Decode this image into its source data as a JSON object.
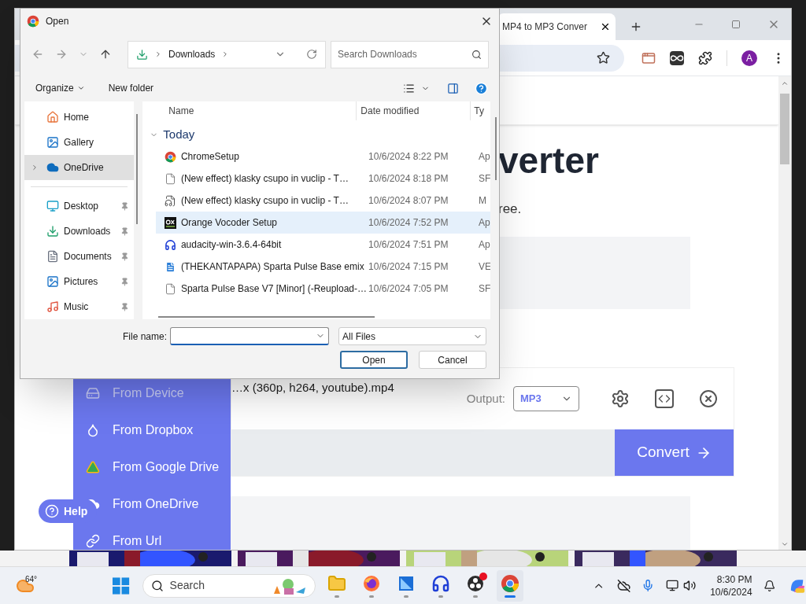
{
  "browser": {
    "tab_title": "MP4 to MP3 Conver",
    "avatar": "A",
    "page": {
      "heading": "verter",
      "subheading": "ree.",
      "file_name": "…x (360p, h264, youtube).mp4",
      "output_label": "Output:",
      "output_format": "MP3",
      "convert_button": "Convert",
      "help_button": "Help",
      "source_menu": [
        {
          "label": "From Device",
          "kind": "device",
          "dimmed": true
        },
        {
          "label": "From Dropbox",
          "kind": "dropbox",
          "dimmed": false
        },
        {
          "label": "From Google Drive",
          "kind": "gdrive",
          "dimmed": false
        },
        {
          "label": "From OneDrive",
          "kind": "onedrive",
          "dimmed": false
        },
        {
          "label": "From Url",
          "kind": "url",
          "dimmed": false
        }
      ]
    }
  },
  "dialog": {
    "title": "Open",
    "path": "Downloads",
    "search_placeholder": "Search Downloads",
    "organize": "Organize",
    "new_folder": "New folder",
    "nav_groups": [
      [
        {
          "label": "Home",
          "kind": "home",
          "selected": false,
          "pinned": false
        },
        {
          "label": "Gallery",
          "kind": "gallery",
          "selected": false,
          "pinned": false
        },
        {
          "label": "OneDrive",
          "kind": "onedrive",
          "selected": true,
          "pinned": false
        }
      ],
      [
        {
          "label": "Desktop",
          "kind": "desktop",
          "selected": false,
          "pinned": true
        },
        {
          "label": "Downloads",
          "kind": "downloads",
          "selected": false,
          "pinned": true
        },
        {
          "label": "Documents",
          "kind": "documents",
          "selected": false,
          "pinned": true
        },
        {
          "label": "Pictures",
          "kind": "pictures",
          "selected": false,
          "pinned": true
        },
        {
          "label": "Music",
          "kind": "music",
          "selected": false,
          "pinned": true
        }
      ]
    ],
    "columns": [
      "Name",
      "Date modified",
      "Ty"
    ],
    "group": "Today",
    "files": [
      {
        "name": "ChromeSetup",
        "date": "10/6/2024 8:22 PM",
        "type": "Ap",
        "kind": "installer",
        "selected": false
      },
      {
        "name": "(New effect) klasky csupo in vuclip - T…",
        "date": "10/6/2024 8:18 PM",
        "type": "SF",
        "kind": "file",
        "selected": false
      },
      {
        "name": "(New effect) klasky csupo in vuclip - T…",
        "date": "10/6/2024 8:07 PM",
        "type": "M",
        "kind": "media",
        "selected": false
      },
      {
        "name": "Orange Vocoder Setup",
        "date": "10/6/2024 7:52 PM",
        "type": "Ap",
        "kind": "vocoder",
        "selected": true
      },
      {
        "name": "audacity-win-3.6.4-64bit",
        "date": "10/6/2024 7:51 PM",
        "type": "Ap",
        "kind": "audacity",
        "selected": false
      },
      {
        "name": "(THEKANTAPAPA) Sparta Pulse Base emix",
        "date": "10/6/2024 7:15 PM",
        "type": "VE",
        "kind": "document",
        "selected": false
      },
      {
        "name": "Sparta Pulse Base V7 [Minor] (-Reupload-…",
        "date": "10/6/2024 7:05 PM",
        "type": "SF",
        "kind": "file",
        "selected": false
      }
    ],
    "file_name_label": "File name:",
    "filter": "All Files",
    "buttons": [
      "Open",
      "Cancel"
    ]
  },
  "taskbar": {
    "temperature": "64°",
    "search_placeholder": "Search",
    "apps": [
      {
        "kind": "explorer",
        "active": false,
        "notification": false
      },
      {
        "kind": "firefox",
        "active": false,
        "notification": false
      },
      {
        "kind": "video",
        "active": false,
        "notification": false
      },
      {
        "kind": "audacity",
        "active": false,
        "notification": false
      },
      {
        "kind": "obs",
        "active": false,
        "notification": true
      },
      {
        "kind": "chrome",
        "active": true,
        "notification": false
      }
    ],
    "time": "8:30 PM",
    "date": "10/6/2024"
  }
}
